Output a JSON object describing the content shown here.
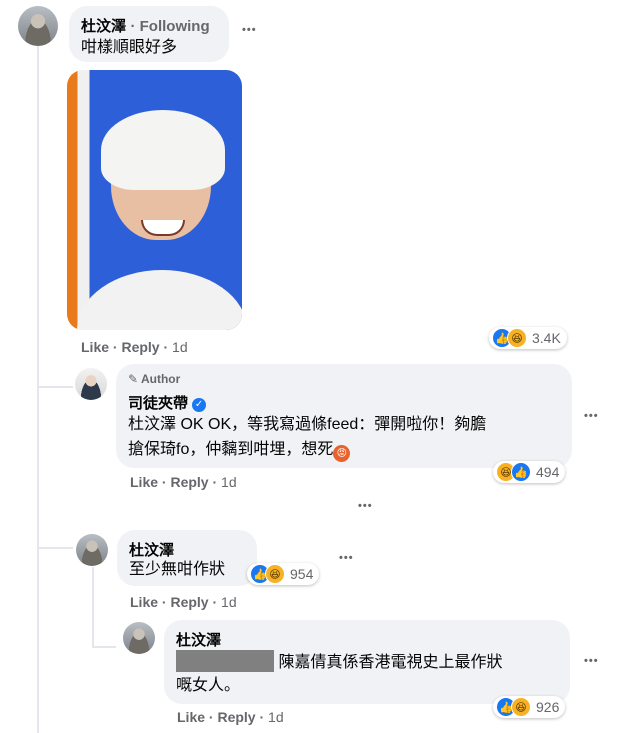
{
  "comment1": {
    "name": "杜汶澤",
    "following": "· Following",
    "text": "咁樣順眼好多",
    "photo_alt": "",
    "reactions": {
      "icons": [
        "like-icon",
        "haha-icon"
      ],
      "count": "3.4K"
    },
    "actions": {
      "like": "Like",
      "reply": "Reply",
      "time": "1d"
    }
  },
  "reply1": {
    "badge": "Author",
    "name": "司徒夾帶",
    "text_line1": "杜汶澤 OK OK，等我寫過條feed：彈開啦你！夠膽",
    "text_line2": "搶保琦fo，仲黐到咁埋，想死",
    "reactions": {
      "icons": [
        "haha-icon",
        "like-icon"
      ],
      "count": "494"
    },
    "actions": {
      "like": "Like",
      "reply": "Reply",
      "time": "1d"
    }
  },
  "more_replies_dots": "•••",
  "reply2": {
    "name": "杜汶澤",
    "text": "至少無咁作狀",
    "reactions": {
      "icons": [
        "like-icon",
        "haha-icon"
      ],
      "count": "954"
    },
    "actions": {
      "like": "Like",
      "reply": "Reply",
      "time": "1d"
    }
  },
  "reply3": {
    "name": "杜汶澤",
    "text_line1": "陳嘉倩真係香港電視史上最作狀",
    "text_line2": "嘅女人。",
    "reactions": {
      "icons": [
        "like-icon",
        "haha-icon"
      ],
      "count": "926"
    },
    "actions": {
      "like": "Like",
      "reply": "Reply",
      "time": "1d"
    }
  },
  "menu_dots": "•••",
  "colors": {
    "like": "#1877f2",
    "haha": "#f7b125",
    "bubble": "#f0f2f5",
    "meta": "#65676b"
  }
}
